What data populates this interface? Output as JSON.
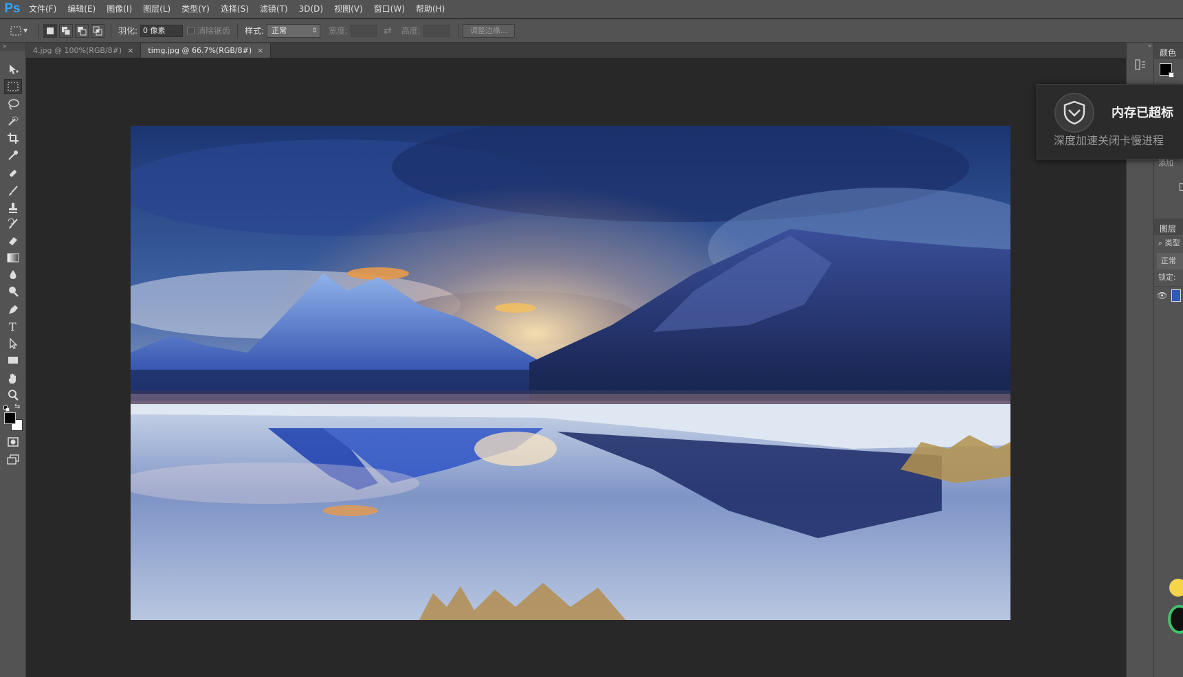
{
  "app": {
    "logo": "Ps"
  },
  "menu": [
    "文件(F)",
    "编辑(E)",
    "图像(I)",
    "图层(L)",
    "类型(Y)",
    "选择(S)",
    "滤镜(T)",
    "3D(D)",
    "视图(V)",
    "窗口(W)",
    "帮助(H)"
  ],
  "options": {
    "feather_label": "羽化:",
    "feather_value": "0 像素",
    "antialias_label": "消除锯齿",
    "style_label": "样式:",
    "style_value": "正常",
    "width_label": "宽度:",
    "height_label": "高度:",
    "refine_edge": "调整边缘..."
  },
  "tabs": [
    {
      "label": "4.jpg @ 100%(RGB/8#)",
      "active": false
    },
    {
      "label": "timg.jpg @ 66.7%(RGB/8#)",
      "active": true
    }
  ],
  "right_panel": {
    "color_tab": "颜色",
    "add_label": "添加",
    "layers_tab": "图层",
    "kind_search": "类型",
    "blend_mode": "正常",
    "lock_label": "锁定:"
  },
  "toast": {
    "title": "内存已超标",
    "subtitle": "深度加速关闭卡慢进程"
  },
  "colors": {
    "accent": "#31a8ff",
    "ui_bg": "#535353",
    "canvas_bg": "#282828",
    "foreground_swatch": "#000000",
    "background_swatch": "#ffffff"
  },
  "icons": {
    "tools": [
      "move-icon",
      "rect-marquee-icon",
      "lasso-icon",
      "quick-select-icon",
      "crop-icon",
      "eyedropper-icon",
      "healing-brush-icon",
      "brush-icon",
      "clone-stamp-icon",
      "history-brush-icon",
      "eraser-icon",
      "gradient-icon",
      "blur-icon",
      "dodge-icon",
      "pen-icon",
      "type-icon",
      "path-select-icon",
      "rectangle-shape-icon",
      "hand-icon",
      "zoom-icon"
    ]
  }
}
